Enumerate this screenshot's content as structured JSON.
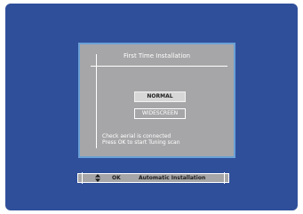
{
  "dialog": {
    "title": "First Time Installation",
    "options": [
      {
        "label": "NORMAL",
        "selected": true
      },
      {
        "label": "WIDESCREEN",
        "selected": false
      }
    ],
    "info_lines": [
      "Check aerial is connected",
      "Press OK to start Tuning scan"
    ]
  },
  "status_bar": {
    "nav_icon": "up-down-arrows-icon",
    "ok_label": "OK",
    "action_label": "Automatic Installation"
  },
  "colors": {
    "screen_bg": "#2f4f9a",
    "dialog_bg": "#a6a6a8",
    "dialog_border": "#6aa0d6",
    "selected_option_bg": "#d7d7d7"
  }
}
